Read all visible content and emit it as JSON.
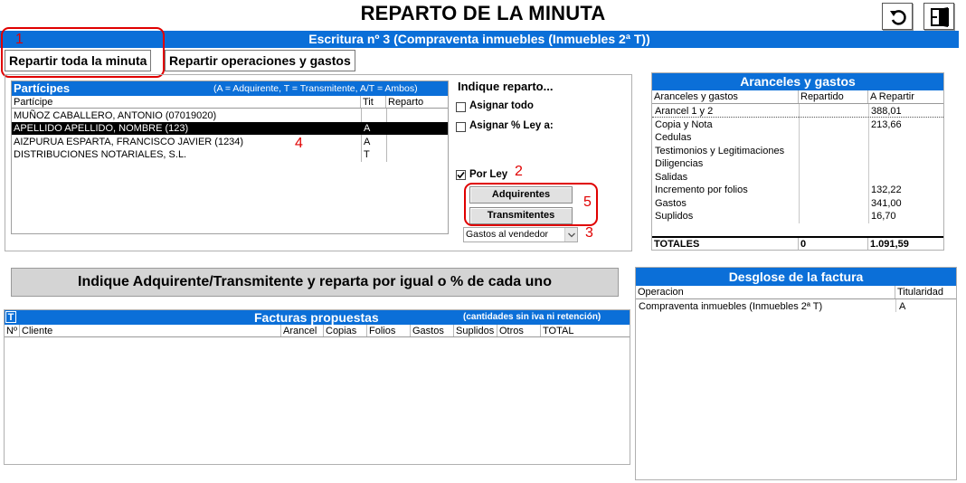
{
  "title": "REPARTO DE LA MINUTA",
  "escritura": "Escritura nº 3 (Compraventa inmuebles (Inmuebles 2ª T))",
  "tabs": {
    "toda": "Repartir toda la minuta",
    "operaciones": "Repartir operaciones y gastos"
  },
  "annotations": {
    "n1": "1",
    "n2": "2",
    "n3": "3",
    "n4": "4",
    "n5": "5"
  },
  "participes": {
    "title": "Partícipes",
    "legend": "(A = Adquirente, T = Transmitente, A/T = Ambos)",
    "columns": [
      "Partícipe",
      "Tit",
      "Reparto"
    ],
    "rows": [
      {
        "name": "MUÑOZ CABALLERO, ANTONIO (07019020)",
        "tit": "",
        "reparto": ""
      },
      {
        "name": "APELLIDO APELLIDO, NOMBRE (123)",
        "tit": "A",
        "reparto": ""
      },
      {
        "name": "AIZPURUA ESPARTA, FRANCISCO JAVIER (1234)",
        "tit": "A",
        "reparto": ""
      },
      {
        "name": "DISTRIBUCIONES NOTARIALES, S.L.",
        "tit": "T",
        "reparto": ""
      }
    ]
  },
  "reparto": {
    "title": "Indique reparto...",
    "asignar_todo": "Asignar todo",
    "asignar_ley": "Asignar % Ley a:",
    "por_ley": "Por Ley",
    "adquirentes": "Adquirentes",
    "transmitentes": "Transmitentes",
    "gastos_select": "Gastos al vendedor"
  },
  "aranceles": {
    "title": "Aranceles y gastos",
    "columns": [
      "Aranceles y gastos",
      "Repartido",
      "A Repartir"
    ],
    "rows": [
      {
        "name": "Arancel 1 y 2",
        "repartido": "",
        "arepartir": "388,01"
      },
      {
        "name": "Copia y Nota",
        "repartido": "",
        "arepartir": "213,66"
      },
      {
        "name": "Cedulas",
        "repartido": "",
        "arepartir": ""
      },
      {
        "name": "Testimonios y Legitimaciones",
        "repartido": "",
        "arepartir": ""
      },
      {
        "name": "Diligencias",
        "repartido": "",
        "arepartir": ""
      },
      {
        "name": "Salidas",
        "repartido": "",
        "arepartir": ""
      },
      {
        "name": "Incremento por folios",
        "repartido": "",
        "arepartir": "132,22"
      },
      {
        "name": "Gastos",
        "repartido": "",
        "arepartir": "341,00"
      },
      {
        "name": "Suplidos",
        "repartido": "",
        "arepartir": "16,70"
      }
    ],
    "totales": {
      "label": "TOTALES",
      "repartido": "0",
      "arepartir": "1.091,59"
    }
  },
  "instruccion": "Indique Adquirente/Transmitente y reparta por igual o % de cada uno",
  "facturas": {
    "t_badge": "T",
    "title": "Facturas propuestas",
    "note": "(cantidades sin iva ni retención)",
    "columns": [
      "Nº",
      "Cliente",
      "Arancel",
      "Copias",
      "Folios",
      "Gastos",
      "Suplidos",
      "Otros",
      "TOTAL"
    ]
  },
  "desglose": {
    "title": "Desglose de la factura",
    "columns": [
      "Operacion",
      "Titularidad"
    ],
    "rows": [
      {
        "operacion": "Compraventa inmuebles (Inmuebles 2ª T)",
        "titularidad": "A"
      }
    ]
  }
}
